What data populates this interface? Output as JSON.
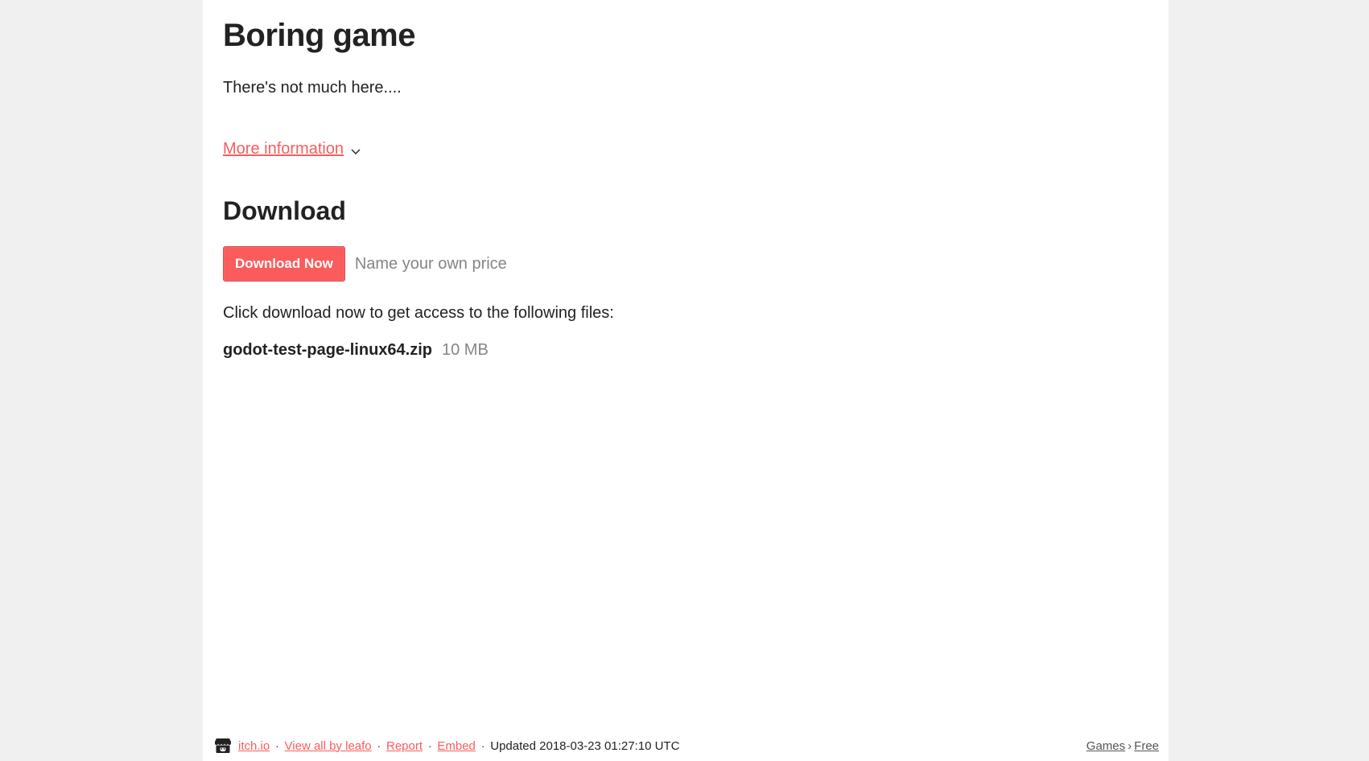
{
  "game": {
    "title": "Boring game",
    "description": "There's not much here...."
  },
  "more_info": {
    "label": "More information",
    "icon": "chevron-down-icon"
  },
  "download": {
    "heading": "Download",
    "button_label": "Download Now",
    "price_note": "Name your own price",
    "files_intro": "Click download now to get access to the following files:",
    "files": [
      {
        "name": "godot-test-page-linux64.zip",
        "size": "10 MB"
      }
    ]
  },
  "footer": {
    "logo_icon": "itch-io-logo-icon",
    "links": {
      "site": "itch.io",
      "view_all": "View all by leafo",
      "report": "Report",
      "embed": "Embed"
    },
    "separator": "·",
    "updated": "Updated 2018-03-23 01:27:10 UTC",
    "breadcrumbs": [
      "Games",
      "Free"
    ],
    "breadcrumb_separator": "›"
  },
  "colors": {
    "accent": "#fa5c5c",
    "text": "#222222",
    "muted": "#858585",
    "page_background": "#f0f0f0",
    "content_background": "#ffffff"
  }
}
